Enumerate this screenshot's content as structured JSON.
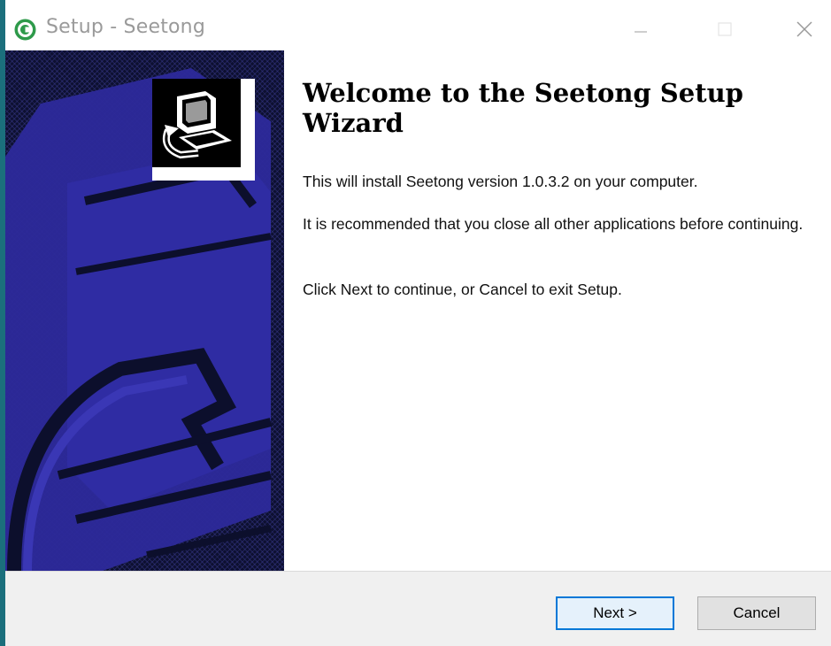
{
  "window": {
    "title": "Setup - Seetong",
    "app_icon": "seetong-logo-icon",
    "controls": [
      "minimize-icon",
      "maximize-icon",
      "close-icon"
    ]
  },
  "banner": {
    "icon": "computer-install-icon",
    "colors": {
      "dark": "#0d1030",
      "blue": "#2d2a9b"
    }
  },
  "content": {
    "heading": "Welcome to the Seetong Setup Wizard",
    "paragraphs": [
      "This will install Seetong version 1.0.3.2 on your computer.",
      "It is recommended that you close all other applications before continuing.",
      "Click Next to continue, or Cancel to exit Setup."
    ]
  },
  "footer": {
    "next_label": "Next >",
    "cancel_label": "Cancel"
  },
  "colors": {
    "accent": "#0078d7",
    "window_border": "#1b6f7c",
    "title_text": "#9a9a9a"
  }
}
